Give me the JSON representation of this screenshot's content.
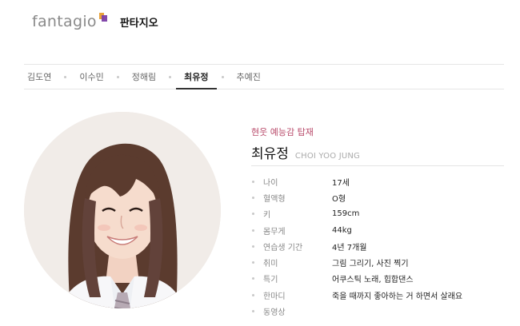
{
  "header": {
    "logo_text": "fantagio",
    "company_name": "판타지오"
  },
  "tabs": [
    {
      "label": "김도연",
      "active": false
    },
    {
      "label": "이수민",
      "active": false
    },
    {
      "label": "정해림",
      "active": false
    },
    {
      "label": "최유정",
      "active": true
    },
    {
      "label": "추예진",
      "active": false
    }
  ],
  "profile": {
    "photo_icon": "profile-photo",
    "tagline": "현웃 예능감 탑재",
    "name": "최유정",
    "name_en": "CHOI YOO JUNG",
    "details": [
      {
        "label": "나이",
        "value": "17세"
      },
      {
        "label": "혈액형",
        "value": "O형"
      },
      {
        "label": "키",
        "value": "159cm"
      },
      {
        "label": "몸무게",
        "value": "44kg"
      },
      {
        "label": "연습생 기간",
        "value": "4년 7개월"
      },
      {
        "label": "취미",
        "value": "그림 그리기, 사진 찍기"
      },
      {
        "label": "특기",
        "value": "어쿠스틱 노래, 힙합댄스"
      },
      {
        "label": "한마디",
        "value": "죽을 때까지 좋아하는 거 하면서 살래요"
      },
      {
        "label": "동영상",
        "value": ""
      }
    ]
  },
  "colors": {
    "accent_tagline": "#b84a6a",
    "logo_orange": "#e8a23a",
    "logo_purple": "#7c3fa6"
  }
}
